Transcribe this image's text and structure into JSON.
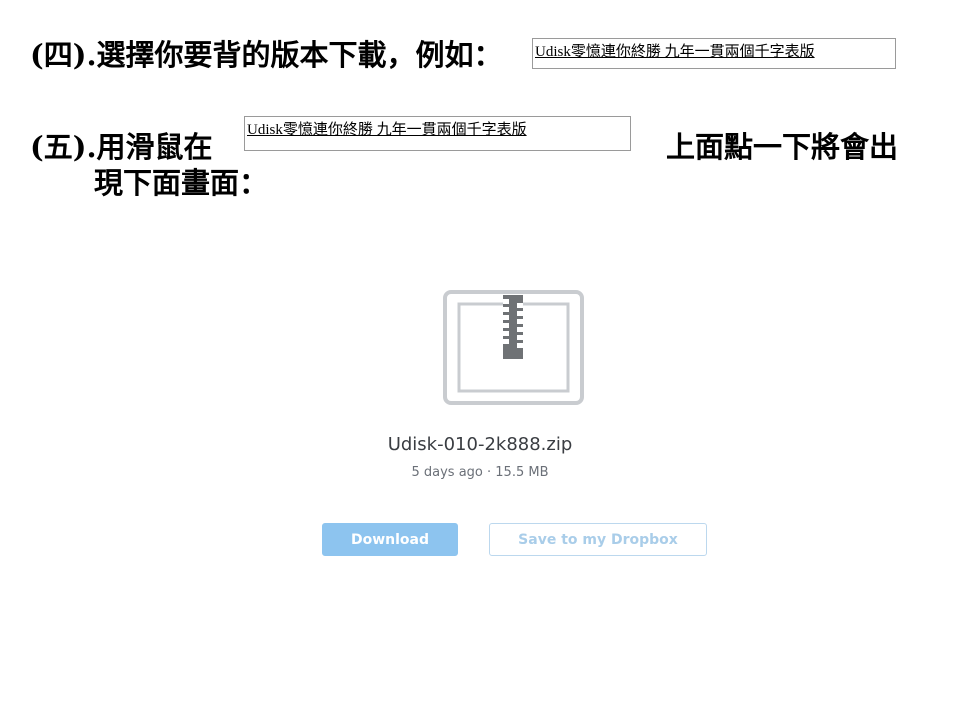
{
  "step4": {
    "text": "(四).選擇你要背的版本下載，例如：",
    "example_box": "Udisk零憶連你終勝 九年一貫兩個千字表版"
  },
  "step5": {
    "text_before": "(五).用滑鼠在",
    "example_box": "Udisk零憶連你終勝 九年一貫兩個千字表版",
    "text_after": "上面點一下將會出",
    "text_line2": "現下面畫面："
  },
  "dropbox_preview": {
    "icon": "zip-file-icon",
    "file_name": "Udisk-010-2k888.zip",
    "meta": "5 days ago · 15.5 MB",
    "download_label": "Download",
    "save_label": "Save to my Dropbox"
  },
  "colors": {
    "download_button": "#8dc4ef",
    "icon_gray": "#c9ccd0",
    "zipper": "#6f7275"
  }
}
